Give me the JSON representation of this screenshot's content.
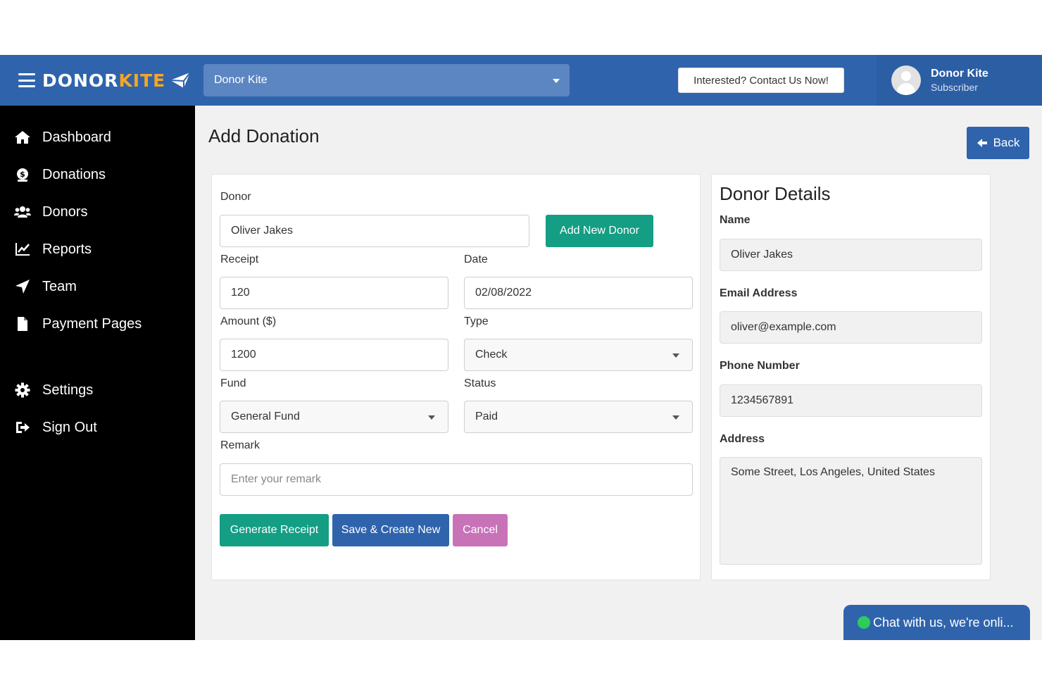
{
  "brand": {
    "name_part1": "DONOR",
    "name_part2": "KITE"
  },
  "org_select": {
    "value": "Donor Kite"
  },
  "contact_button": "Interested? Contact Us Now!",
  "user": {
    "name": "Donor Kite",
    "role": "Subscriber"
  },
  "sidebar": {
    "items": [
      {
        "label": "Dashboard",
        "icon": "home-icon"
      },
      {
        "label": "Donations",
        "icon": "money-bag-icon"
      },
      {
        "label": "Donors",
        "icon": "users-icon"
      },
      {
        "label": "Reports",
        "icon": "chart-icon"
      },
      {
        "label": "Team",
        "icon": "paper-plane-icon"
      },
      {
        "label": "Payment Pages",
        "icon": "file-icon"
      },
      {
        "label": "Settings",
        "icon": "gear-icon"
      },
      {
        "label": "Sign Out",
        "icon": "sign-out-icon"
      }
    ]
  },
  "page": {
    "title": "Add Donation",
    "back_label": "Back"
  },
  "form": {
    "donor_label": "Donor",
    "donor_value": "Oliver Jakes",
    "add_donor_label": "Add New Donor",
    "receipt_label": "Receipt",
    "receipt_value": "120",
    "date_label": "Date",
    "date_value": "02/08/2022",
    "amount_label": "Amount ($)",
    "amount_value": "1200",
    "type_label": "Type",
    "type_value": "Check",
    "fund_label": "Fund",
    "fund_value": "General Fund",
    "status_label": "Status",
    "status_value": "Paid",
    "remark_label": "Remark",
    "remark_placeholder": "Enter your remark",
    "generate_label": "Generate Receipt",
    "save_label": "Save & Create New",
    "cancel_label": "Cancel"
  },
  "details": {
    "title": "Donor Details",
    "name_label": "Name",
    "name_value": "Oliver Jakes",
    "email_label": "Email Address",
    "email_value": "oliver@example.com",
    "phone_label": "Phone Number",
    "phone_value": "1234567891",
    "address_label": "Address",
    "address_value": "Some Street, Los Angeles, United States"
  },
  "chat": {
    "label": "Chat with us, we're onli..."
  },
  "colors": {
    "primary": "#2f64ad",
    "teal": "#149e84",
    "pink": "#c872b8",
    "brand_accent": "#f5a623",
    "online": "#2ecc5b"
  }
}
